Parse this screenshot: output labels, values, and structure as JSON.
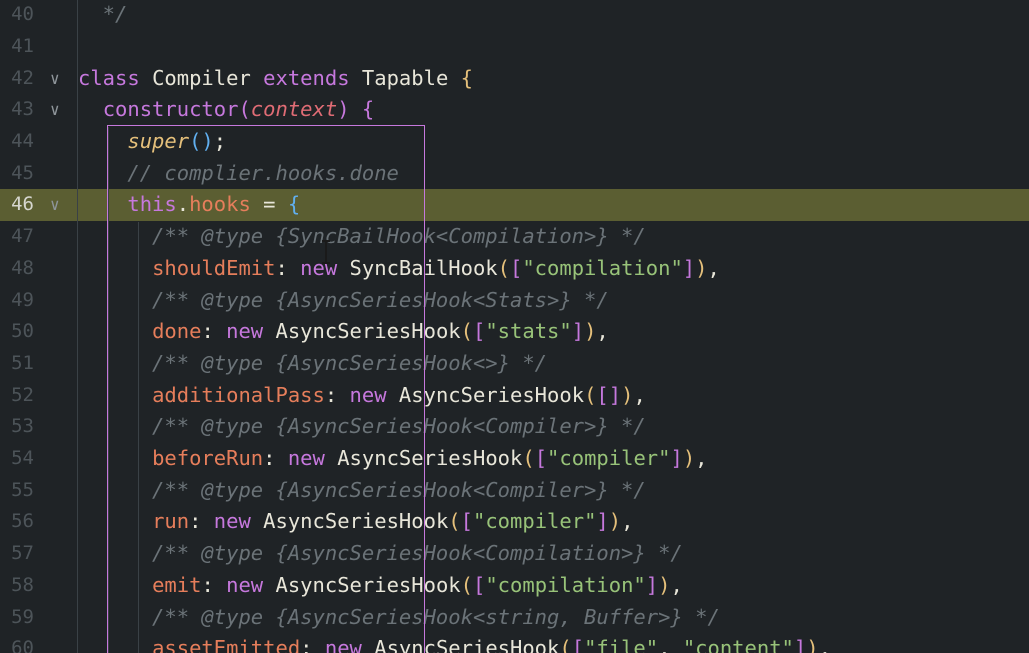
{
  "editor": {
    "active_line": "46",
    "colors": {
      "background": "#1f2326",
      "active_line": "#5b5e32",
      "keyword": "#c678dd",
      "type": "#e8e6d9",
      "string": "#98c379",
      "comment": "#6b7378",
      "property": "#e67e5b",
      "parameter": "#e06c75",
      "bracket_1": "#e5c07b",
      "bracket_2": "#c678dd",
      "bracket_3": "#61afef"
    },
    "lines": [
      {
        "n": "40",
        "fold": false,
        "tokens": [
          [
            "comment",
            "  */"
          ]
        ]
      },
      {
        "n": "41",
        "fold": false,
        "tokens": []
      },
      {
        "n": "42",
        "fold": true,
        "tokens": [
          [
            "kw",
            "class "
          ],
          [
            "ty",
            "Compiler "
          ],
          [
            "kw",
            "extends "
          ],
          [
            "ty",
            "Tapable "
          ],
          [
            "b1",
            "{"
          ]
        ]
      },
      {
        "n": "43",
        "fold": true,
        "tokens": [
          [
            "pl",
            "  "
          ],
          [
            "fn",
            "constructor"
          ],
          [
            "b2",
            "("
          ],
          [
            "par",
            "context"
          ],
          [
            "b2",
            ")"
          ],
          [
            "pl",
            " "
          ],
          [
            "b2",
            "{"
          ]
        ]
      },
      {
        "n": "44",
        "fold": false,
        "tokens": [
          [
            "pl",
            "    "
          ],
          [
            "sup",
            "super"
          ],
          [
            "b3",
            "()"
          ],
          [
            "pl",
            ";"
          ]
        ]
      },
      {
        "n": "45",
        "fold": false,
        "tokens": [
          [
            "comment",
            "    // complier.hooks.done"
          ]
        ]
      },
      {
        "n": "46",
        "fold": true,
        "tokens": [
          [
            "pl",
            "    "
          ],
          [
            "kw",
            "this"
          ],
          [
            "pl",
            "."
          ],
          [
            "prop",
            "hooks"
          ],
          [
            "pl",
            " = "
          ],
          [
            "b3",
            "{"
          ]
        ]
      },
      {
        "n": "47",
        "fold": false,
        "tokens": [
          [
            "comment",
            "      /** @type {SyncBailHook<Compilation>} */"
          ]
        ]
      },
      {
        "n": "48",
        "fold": false,
        "tokens": [
          [
            "pl",
            "      "
          ],
          [
            "key",
            "shouldEmit"
          ],
          [
            "pl",
            ": "
          ],
          [
            "kw",
            "new "
          ],
          [
            "ty",
            "SyncBailHook"
          ],
          [
            "b1",
            "("
          ],
          [
            "b2",
            "["
          ],
          [
            "str",
            "\"compilation\""
          ],
          [
            "b2",
            "]"
          ],
          [
            "b1",
            ")"
          ],
          [
            "pl",
            ","
          ]
        ]
      },
      {
        "n": "49",
        "fold": false,
        "tokens": [
          [
            "comment",
            "      /** @type {AsyncSeriesHook<Stats>} */"
          ]
        ]
      },
      {
        "n": "50",
        "fold": false,
        "tokens": [
          [
            "pl",
            "      "
          ],
          [
            "key",
            "done"
          ],
          [
            "pl",
            ": "
          ],
          [
            "kw",
            "new "
          ],
          [
            "ty",
            "AsyncSeriesHook"
          ],
          [
            "b1",
            "("
          ],
          [
            "b2",
            "["
          ],
          [
            "str",
            "\"stats\""
          ],
          [
            "b2",
            "]"
          ],
          [
            "b1",
            ")"
          ],
          [
            "pl",
            ","
          ]
        ]
      },
      {
        "n": "51",
        "fold": false,
        "tokens": [
          [
            "comment",
            "      /** @type {AsyncSeriesHook<>} */"
          ]
        ]
      },
      {
        "n": "52",
        "fold": false,
        "tokens": [
          [
            "pl",
            "      "
          ],
          [
            "key",
            "additionalPass"
          ],
          [
            "pl",
            ": "
          ],
          [
            "kw",
            "new "
          ],
          [
            "ty",
            "AsyncSeriesHook"
          ],
          [
            "b1",
            "("
          ],
          [
            "b2",
            "[]"
          ],
          [
            "b1",
            ")"
          ],
          [
            "pl",
            ","
          ]
        ]
      },
      {
        "n": "53",
        "fold": false,
        "tokens": [
          [
            "comment",
            "      /** @type {AsyncSeriesHook<Compiler>} */"
          ]
        ]
      },
      {
        "n": "54",
        "fold": false,
        "tokens": [
          [
            "pl",
            "      "
          ],
          [
            "key",
            "beforeRun"
          ],
          [
            "pl",
            ": "
          ],
          [
            "kw",
            "new "
          ],
          [
            "ty",
            "AsyncSeriesHook"
          ],
          [
            "b1",
            "("
          ],
          [
            "b2",
            "["
          ],
          [
            "str",
            "\"compiler\""
          ],
          [
            "b2",
            "]"
          ],
          [
            "b1",
            ")"
          ],
          [
            "pl",
            ","
          ]
        ]
      },
      {
        "n": "55",
        "fold": false,
        "tokens": [
          [
            "comment",
            "      /** @type {AsyncSeriesHook<Compiler>} */"
          ]
        ]
      },
      {
        "n": "56",
        "fold": false,
        "tokens": [
          [
            "pl",
            "      "
          ],
          [
            "key",
            "run"
          ],
          [
            "pl",
            ": "
          ],
          [
            "kw",
            "new "
          ],
          [
            "ty",
            "AsyncSeriesHook"
          ],
          [
            "b1",
            "("
          ],
          [
            "b2",
            "["
          ],
          [
            "str",
            "\"compiler\""
          ],
          [
            "b2",
            "]"
          ],
          [
            "b1",
            ")"
          ],
          [
            "pl",
            ","
          ]
        ]
      },
      {
        "n": "57",
        "fold": false,
        "tokens": [
          [
            "comment",
            "      /** @type {AsyncSeriesHook<Compilation>} */"
          ]
        ]
      },
      {
        "n": "58",
        "fold": false,
        "tokens": [
          [
            "pl",
            "      "
          ],
          [
            "key",
            "emit"
          ],
          [
            "pl",
            ": "
          ],
          [
            "kw",
            "new "
          ],
          [
            "ty",
            "AsyncSeriesHook"
          ],
          [
            "b1",
            "("
          ],
          [
            "b2",
            "["
          ],
          [
            "str",
            "\"compilation\""
          ],
          [
            "b2",
            "]"
          ],
          [
            "b1",
            ")"
          ],
          [
            "pl",
            ","
          ]
        ]
      },
      {
        "n": "59",
        "fold": false,
        "tokens": [
          [
            "comment",
            "      /** @type {AsyncSeriesHook<string, Buffer>} */"
          ]
        ]
      },
      {
        "n": "60",
        "fold": false,
        "tokens": [
          [
            "pl",
            "      "
          ],
          [
            "key",
            "assetEmitted"
          ],
          [
            "pl",
            ": "
          ],
          [
            "kw",
            "new "
          ],
          [
            "ty",
            "AsyncSeriesHook"
          ],
          [
            "b1",
            "("
          ],
          [
            "b2",
            "["
          ],
          [
            "str",
            "\"file\""
          ],
          [
            "pl",
            ", "
          ],
          [
            "str",
            "\"content\""
          ],
          [
            "b2",
            "]"
          ],
          [
            "b1",
            ")"
          ],
          [
            "pl",
            ","
          ]
        ]
      }
    ]
  }
}
